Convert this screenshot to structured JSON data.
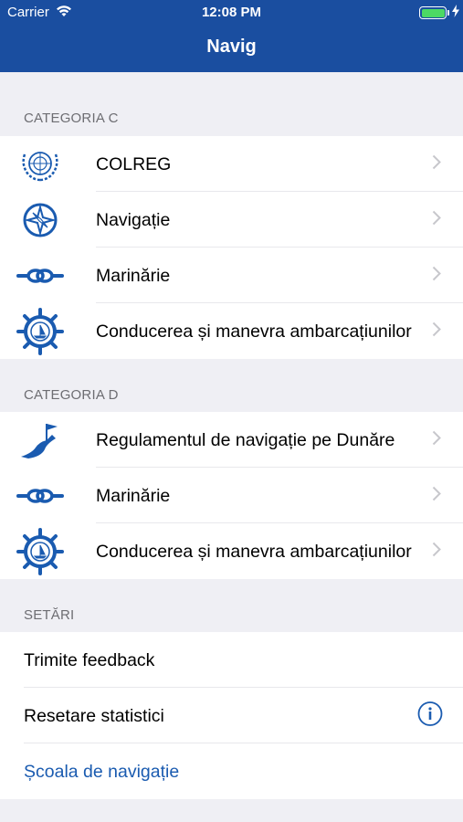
{
  "status_bar": {
    "carrier": "Carrier",
    "time": "12:08 PM",
    "battery_level": 1.0
  },
  "navbar": {
    "title": "Navig"
  },
  "sections": {
    "c": {
      "header": "CATEGORIA C",
      "items": [
        {
          "label": "COLREG",
          "icon": "un-emblem-icon"
        },
        {
          "label": "Navigație",
          "icon": "compass-rose-icon"
        },
        {
          "label": "Marinărie",
          "icon": "rope-knot-icon"
        },
        {
          "label": "Conducerea și manevra ambarcațiunilor",
          "icon": "ship-wheel-icon"
        }
      ]
    },
    "d": {
      "header": "CATEGORIA D",
      "items": [
        {
          "label": "Regulamentul de navigație pe Dunăre",
          "icon": "river-flag-icon"
        },
        {
          "label": "Marinărie",
          "icon": "rope-knot-icon"
        },
        {
          "label": "Conducerea și manevra ambarcațiunilor",
          "icon": "ship-wheel-icon"
        }
      ]
    },
    "settings": {
      "header": "SETĂRI",
      "items": [
        {
          "label": "Trimite feedback"
        },
        {
          "label": "Resetare statistici",
          "accessory": "info-icon"
        },
        {
          "label": "Școala de navigație",
          "style": "link"
        }
      ]
    }
  },
  "colors": {
    "brand": "#1a4ea0",
    "link": "#1a5bb0",
    "background": "#efeff4"
  }
}
